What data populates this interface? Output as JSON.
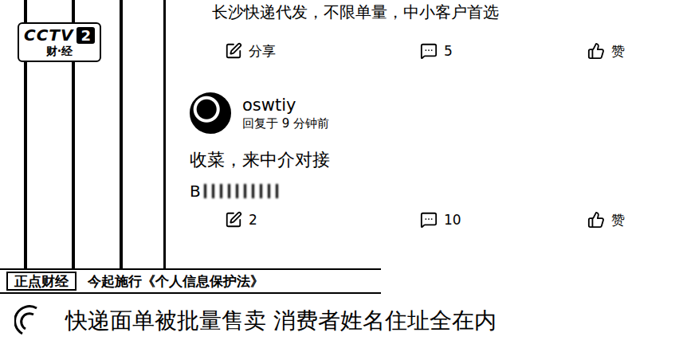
{
  "channel_logo": {
    "name": "CCTV",
    "number": "2",
    "subtitle": "财·经"
  },
  "feed": {
    "top_post": {
      "text": "长沙快递代发，不限单量，中小客户首选",
      "actions": {
        "share": "分享",
        "comments": "5",
        "like": "赞"
      }
    },
    "comments": [
      {
        "username": "oswtiy",
        "meta": "回复于 9 分钟前",
        "text": "收菜，来中介对接",
        "contact_prefix": "B",
        "contact_redacted": true,
        "actions": {
          "share": "2",
          "comments": "10",
          "like": "赞"
        }
      }
    ]
  },
  "news_banner": {
    "program": "正点财经",
    "topic": "今起施行《个人信息保护法》",
    "headline": "快递面单被批量售卖 消费者姓名住址全在内"
  }
}
